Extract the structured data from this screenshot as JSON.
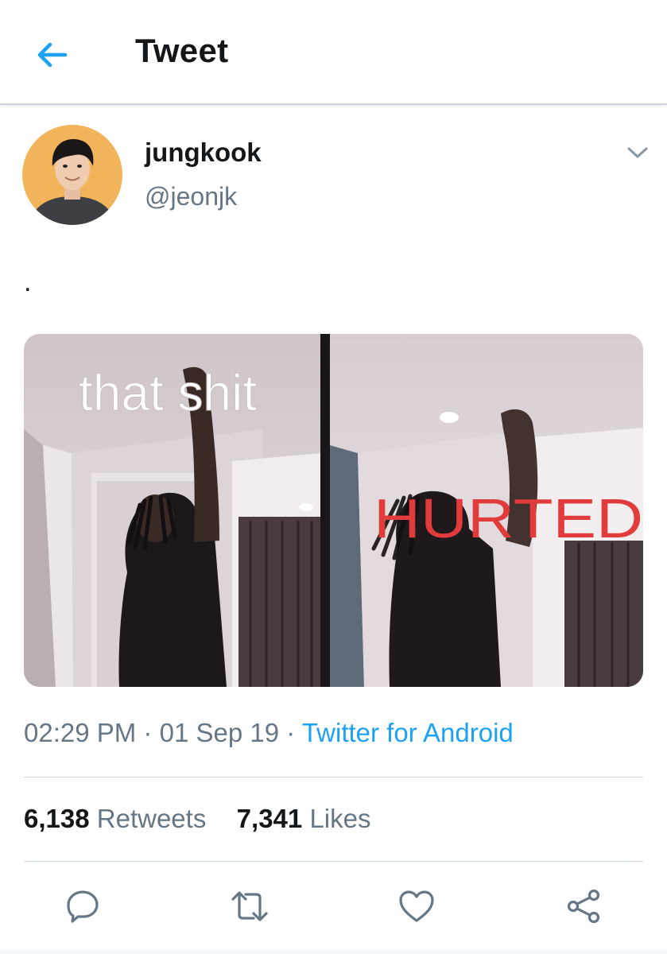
{
  "header": {
    "title": "Tweet",
    "back_icon": "arrow-left-icon"
  },
  "author": {
    "display_name": "jungkook",
    "handle": "@jeonjk",
    "avatar_bg": "#f2b45a"
  },
  "tweet": {
    "text": "."
  },
  "media": {
    "caption_left": "that shit",
    "caption_right": "HURTED",
    "caption_right_color": "#e23b3b"
  },
  "meta": {
    "time": "02:29 PM",
    "sep1": "·",
    "date": "01 Sep 19",
    "sep2": "·",
    "source": "Twitter for Android"
  },
  "stats": {
    "retweets_count": "6,138",
    "retweets_label": "Retweets",
    "likes_count": "7,341",
    "likes_label": "Likes"
  },
  "actions": {
    "reply_icon": "reply-icon",
    "retweet_icon": "retweet-icon",
    "like_icon": "heart-icon",
    "share_icon": "share-icon"
  },
  "colors": {
    "accent": "#1da1f2",
    "secondary_text": "#657786",
    "icon_gray": "#657786"
  }
}
